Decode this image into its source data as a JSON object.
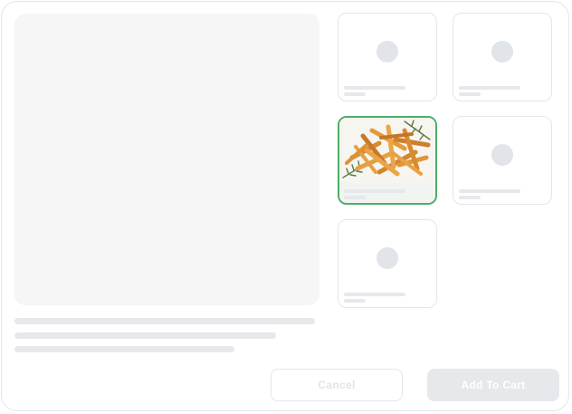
{
  "product_grid": {
    "items": [
      {
        "type": "placeholder",
        "selected": false
      },
      {
        "type": "placeholder",
        "selected": false
      },
      {
        "type": "image",
        "image_subject": "french-fries",
        "selected": true
      },
      {
        "type": "placeholder",
        "selected": false
      },
      {
        "type": "placeholder",
        "selected": false
      }
    ]
  },
  "actions": {
    "cancel_label": "Cancel",
    "add_label": "Add To Cart"
  },
  "colors": {
    "selected_border": "#4caf65",
    "skeleton": "#e6e8ec",
    "preview_bg": "#f6f6f7"
  }
}
